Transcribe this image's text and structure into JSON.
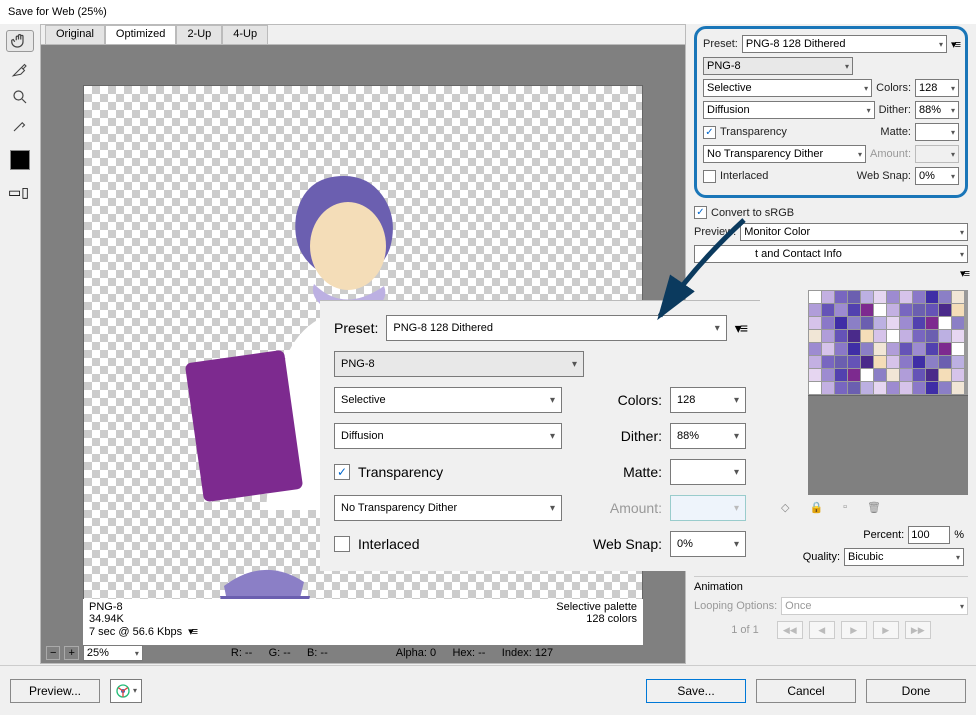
{
  "window": {
    "title": "Save for Web (25%)"
  },
  "tabs": {
    "original": "Original",
    "optimized": "Optimized",
    "twoup": "2-Up",
    "fourup": "4-Up"
  },
  "stats": {
    "format": "PNG-8",
    "size": "34.94K",
    "time": "7 sec @ 56.6 Kbps",
    "palette": "Selective palette",
    "colors": "128 colors"
  },
  "infobar": {
    "zoom": "25%",
    "r": "R: --",
    "g": "G: --",
    "b": "B: --",
    "alpha": "Alpha: 0",
    "hex": "Hex: --",
    "index": "Index: 127"
  },
  "settings": {
    "preset_label": "Preset:",
    "preset": "PNG-8 128 Dithered",
    "filetype": "PNG-8",
    "reduction": "Selective",
    "colors_label": "Colors:",
    "colors": "128",
    "dither_method": "Diffusion",
    "dither_label": "Dither:",
    "dither": "88%",
    "transparency_label": "Transparency",
    "matte_label": "Matte:",
    "matte": "",
    "trans_dither": "No Transparency Dither",
    "amount_label": "Amount:",
    "amount": "",
    "interlaced_label": "Interlaced",
    "websnap_label": "Web Snap:",
    "websnap": "0%",
    "convert_label": "Convert to sRGB",
    "preview_label": "Preview:",
    "preview_value": "Monitor Color",
    "metadata": "t and Contact Info"
  },
  "sizing": {
    "percent_label": "Percent:",
    "percent": "100",
    "percent_unit": "%",
    "quality_label": "Quality:",
    "quality": "Bicubic"
  },
  "animation": {
    "header": "Animation",
    "looping_label": "Looping Options:",
    "looping": "Once",
    "frame": "1 of 1"
  },
  "buttons": {
    "preview": "Preview...",
    "save": "Save...",
    "cancel": "Cancel",
    "done": "Done"
  }
}
